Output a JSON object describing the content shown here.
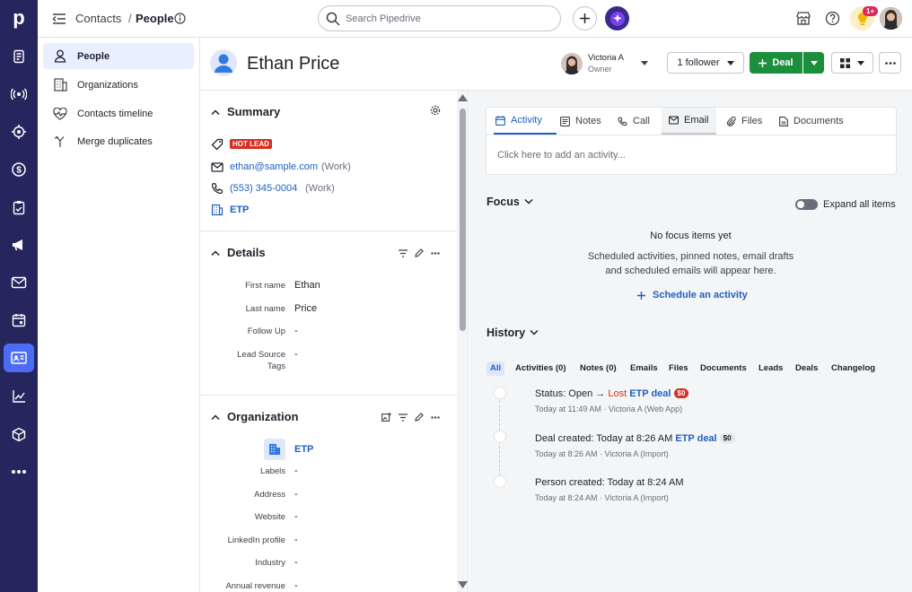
{
  "app": {
    "logo": "p",
    "accent": "#26265f",
    "primary": "#4d6cf5",
    "green": "#1b8f3c"
  },
  "rail": {
    "icons": [
      "leads-icon",
      "deals-icon",
      "focus-icon",
      "money-icon",
      "tasks-icon",
      "campaigns-icon",
      "mail-icon",
      "calendar-icon",
      "contacts-icon",
      "insights-icon",
      "products-icon",
      "more-icon"
    ],
    "active_index": 8
  },
  "topbar": {
    "breadcrumb_parent": "Contacts",
    "breadcrumb_sep": "/",
    "breadcrumb_current": "People",
    "search_placeholder": "Search Pipedrive",
    "notif_badge": "1+"
  },
  "nav": {
    "items": [
      {
        "label": "People",
        "icon": "person-icon"
      },
      {
        "label": "Organizations",
        "icon": "building-icon"
      },
      {
        "label": "Contacts timeline",
        "icon": "heart-pulse-icon"
      },
      {
        "label": "Merge duplicates",
        "icon": "merge-icon"
      }
    ]
  },
  "person": {
    "name": "Ethan Price",
    "owner_name": "Victoria A",
    "owner_role": "Owner",
    "follower_label": "1 follower",
    "deal_label": "Deal"
  },
  "summary": {
    "title": "Summary",
    "label_tag": "HOT LEAD",
    "email": "ethan@sample.com",
    "email_type": "(Work)",
    "phone": "(553) 345-0004",
    "phone_type": "(Work)",
    "org": "ETP"
  },
  "details": {
    "title": "Details",
    "fields": [
      {
        "label": "First name",
        "value": "Ethan"
      },
      {
        "label": "Last name",
        "value": "Price"
      },
      {
        "label": "Follow Up",
        "value": "-"
      },
      {
        "label": "Lead Source",
        "label2": "Tags",
        "value": "-"
      }
    ]
  },
  "organization": {
    "title": "Organization",
    "name": "ETP",
    "fields": [
      {
        "label": "Labels",
        "value": "-"
      },
      {
        "label": "Address",
        "value": "-"
      },
      {
        "label": "Website",
        "value": "-"
      },
      {
        "label": "LinkedIn profile",
        "value": "-"
      },
      {
        "label": "Industry",
        "value": "-"
      },
      {
        "label": "Annual revenue",
        "value": "-"
      }
    ]
  },
  "composer": {
    "tabs": [
      "Activity",
      "Notes",
      "Call",
      "Email",
      "Files",
      "Documents"
    ],
    "placeholder": "Click here to add an activity..."
  },
  "focus": {
    "title": "Focus",
    "expand_label": "Expand all items",
    "empty_title": "No focus items yet",
    "empty_line1": "Scheduled activities, pinned notes, email drafts",
    "empty_line2": "and scheduled emails will appear here.",
    "schedule_label": "Schedule an activity"
  },
  "history": {
    "title": "History",
    "tabs": [
      "All",
      "Activities (0)",
      "Notes (0)",
      "Emails",
      "Files",
      "Documents",
      "Leads",
      "Deals",
      "Changelog"
    ],
    "items": [
      {
        "prefix": "Status",
        "text": ": Open → ",
        "status": "Lost",
        "link": "ETP deal",
        "badge": "$0",
        "meta": "Today at 11:49 AM · Victoria A (Web App)"
      },
      {
        "prefix": "Deal created",
        "text": ": Today at 8:26 AM ",
        "link": "ETP deal",
        "badge": "$0",
        "meta": "Today at 8:26 AM · Victoria A (Import)"
      },
      {
        "prefix": "Person created",
        "text": ": Today at 8:24 AM",
        "meta": "Today at 8:24 AM · Victoria A (Import)"
      }
    ]
  }
}
